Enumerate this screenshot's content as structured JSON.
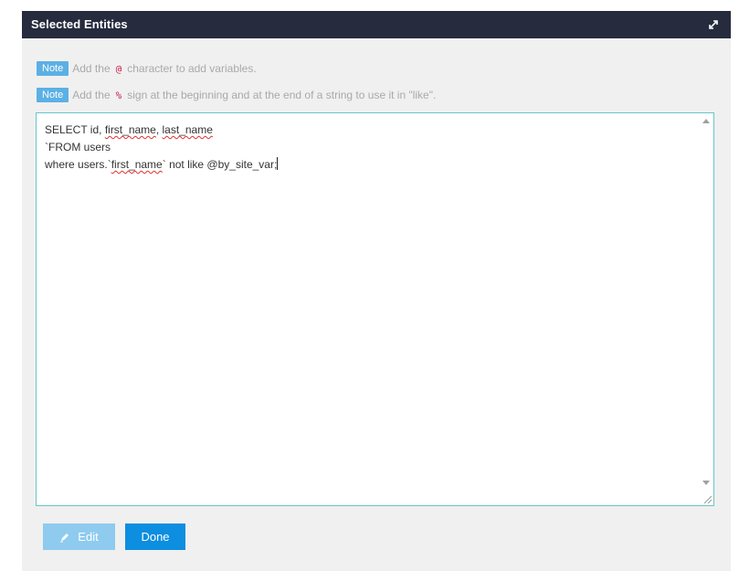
{
  "panel": {
    "title": "Selected Entities",
    "expand_icon": "expand-arrows-icon"
  },
  "notes": [
    {
      "badge": "Note",
      "before": "Add the",
      "code": "@",
      "after": "character to add variables."
    },
    {
      "badge": "Note",
      "before": "Add the",
      "code": "%",
      "after": "sign at the beginning and at the end of a string to use it in \"like\"."
    }
  ],
  "editor": {
    "line1_a": "SELECT id, ",
    "line1_b": "first_name",
    "line1_c": ", ",
    "line1_d": "last_name",
    "line2": "`FROM users",
    "line3_a": "where users.`",
    "line3_b": "first_name",
    "line3_c": "` not like @by_site_var;"
  },
  "buttons": {
    "edit_label": "Edit",
    "done_label": "Done",
    "edit_icon": "pencil-icon"
  },
  "colors": {
    "header_bg": "#262b3e",
    "note_badge": "#5bb0e4",
    "edit_button": "#8ecbef",
    "done_button": "#0d8ee0",
    "editor_border": "#66c7c9"
  }
}
